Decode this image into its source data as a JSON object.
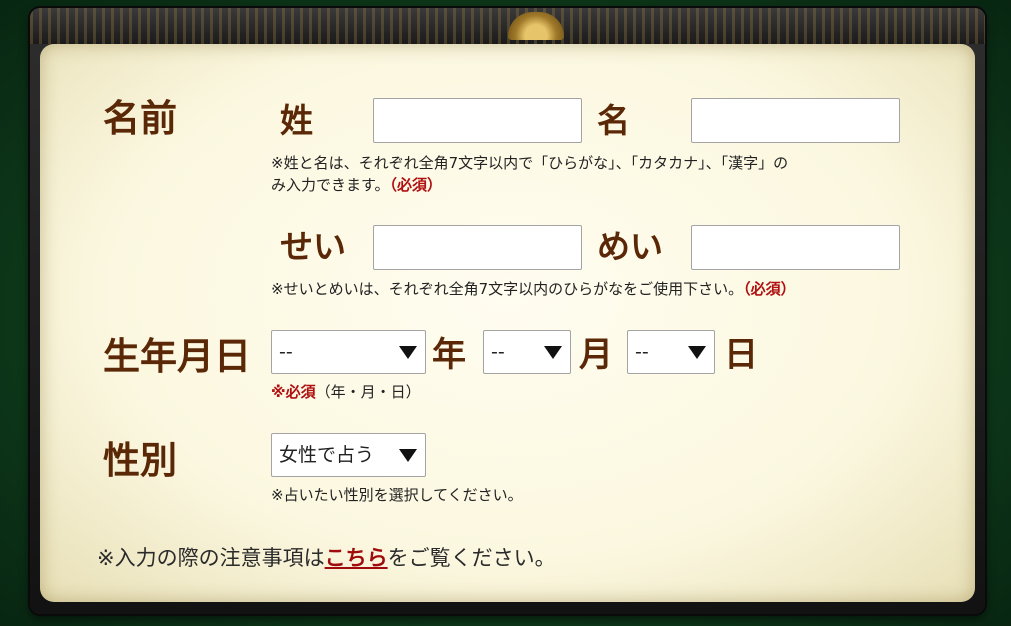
{
  "name": {
    "section_label": "名前",
    "sei_label": "姓",
    "mei_label": "名",
    "sei_value": "",
    "mei_value": "",
    "note_line1": "※姓と名は、それぞれ全角7文字以内で「ひらがな」、「カタカナ」、「漢字」の",
    "note_line2": "み入力できます。",
    "required": "（必須）"
  },
  "kana": {
    "sei_label": "せい",
    "mei_label": "めい",
    "sei_value": "",
    "mei_value": "",
    "note": "※せいとめいは、それぞれ全角7文字以内のひらがなをご使用下さい。",
    "required": "（必須）"
  },
  "birthday": {
    "section_label": "生年月日",
    "year_selected": "--",
    "month_selected": "--",
    "day_selected": "--",
    "year_unit": "年",
    "month_unit": "月",
    "day_unit": "日",
    "required_mark": "※必須",
    "note": "（年・月・日）"
  },
  "gender": {
    "section_label": "性別",
    "selected": "女性で占う",
    "note": "※占いたい性別を選択してください。"
  },
  "footer": {
    "prefix": "※入力の際の注意事項は",
    "link_text": "こちら",
    "suffix": "をご覧ください。"
  },
  "colors": {
    "label_brown": "#5a2806",
    "required_red": "#b01010",
    "panel_cream": "#fbf7df",
    "background_green": "#0f3d1b"
  }
}
